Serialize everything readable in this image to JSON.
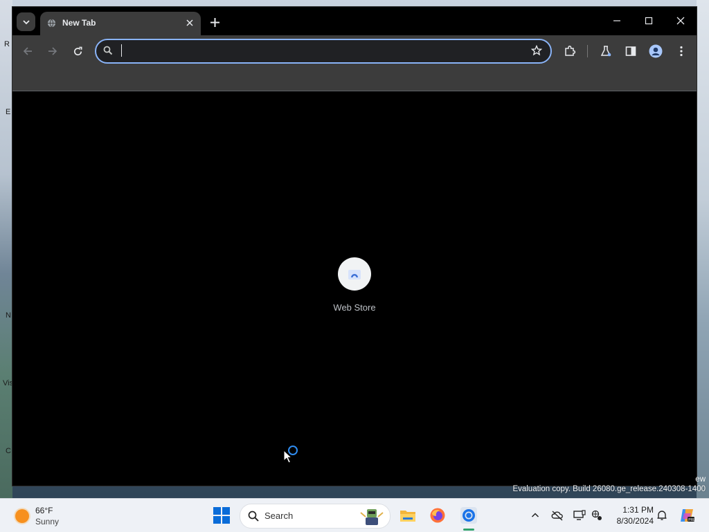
{
  "browser": {
    "tab_title": "New Tab",
    "omnibox_value": "",
    "omnibox_placeholder": ""
  },
  "newtab": {
    "shortcuts": [
      {
        "label": "Web Store"
      }
    ]
  },
  "desktop": {
    "watermark_line1": "ew",
    "watermark_line2": "Evaluation copy. Build 26080.ge_release.240308-1400",
    "left_edge_glyphs": [
      "R",
      "E",
      "N",
      "Vis",
      "C"
    ]
  },
  "taskbar": {
    "weather_temp": "66°F",
    "weather_condition": "Sunny",
    "search_label": "Search",
    "clock_time": "1:31 PM",
    "clock_date": "8/30/2024"
  },
  "colors": {
    "accent": "#8ab4f8",
    "toolbar": "#3c3c3c",
    "windows_blue": "#0a6cd8"
  }
}
